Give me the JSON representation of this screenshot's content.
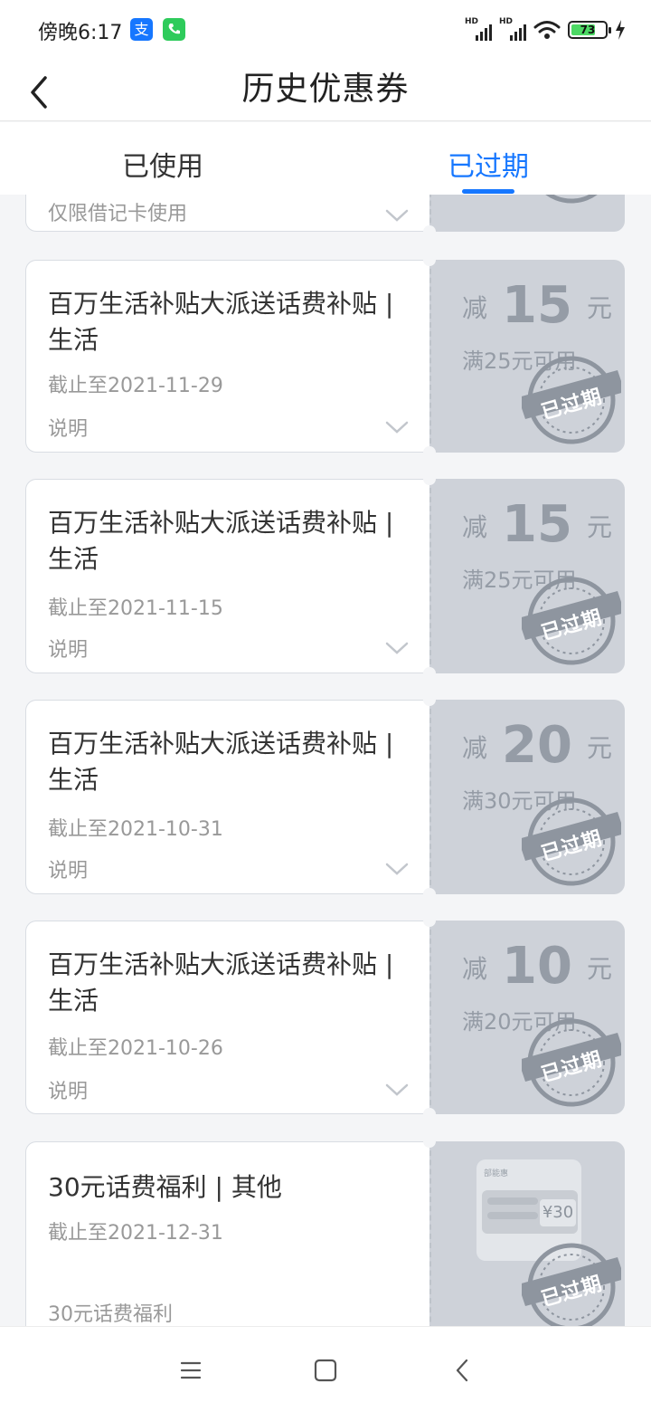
{
  "status_bar": {
    "time": "傍晚6:17",
    "battery": "73",
    "net_label": "HD",
    "icons": [
      "alipay-icon",
      "phone-icon",
      "signal-icon",
      "signal-icon",
      "wifi-icon",
      "battery-icon",
      "charging-icon"
    ]
  },
  "header": {
    "title": "历史优惠券"
  },
  "tabs": [
    {
      "label": "已使用",
      "active": false
    },
    {
      "label": "已过期",
      "active": true
    }
  ],
  "partial_coupon": {
    "desc": "仅限借记卡使用"
  },
  "coupons": [
    {
      "title": "百万生活补贴大派送话费补贴 | 生活",
      "date": "截止至2021-11-29",
      "desc": "说明",
      "prefix": "减",
      "amount": "15",
      "unit": "元",
      "condition": "满25元可用",
      "stamp": "已过期"
    },
    {
      "title": "百万生活补贴大派送话费补贴 | 生活",
      "date": "截止至2021-11-15",
      "desc": "说明",
      "prefix": "减",
      "amount": "15",
      "unit": "元",
      "condition": "满25元可用",
      "stamp": "已过期"
    },
    {
      "title": "百万生活补贴大派送话费补贴 | 生活",
      "date": "截止至2021-10-31",
      "desc": "说明",
      "prefix": "减",
      "amount": "20",
      "unit": "元",
      "condition": "满30元可用",
      "stamp": "已过期"
    },
    {
      "title": "百万生活补贴大派送话费补贴 | 生活",
      "date": "截止至2021-10-26",
      "desc": "说明",
      "prefix": "减",
      "amount": "10",
      "unit": "元",
      "condition": "满20元可用",
      "stamp": "已过期"
    },
    {
      "title": "30元话费福利 | 其他",
      "date": "截止至2021-12-31",
      "desc": "30元话费福利",
      "stamp": "已过期",
      "thumb_brand": "部能惠",
      "thumb_value": "¥30"
    }
  ],
  "colors": {
    "accent": "#1677ff",
    "expired_bg": "#ced2d9",
    "stamp": "#8e959f"
  }
}
